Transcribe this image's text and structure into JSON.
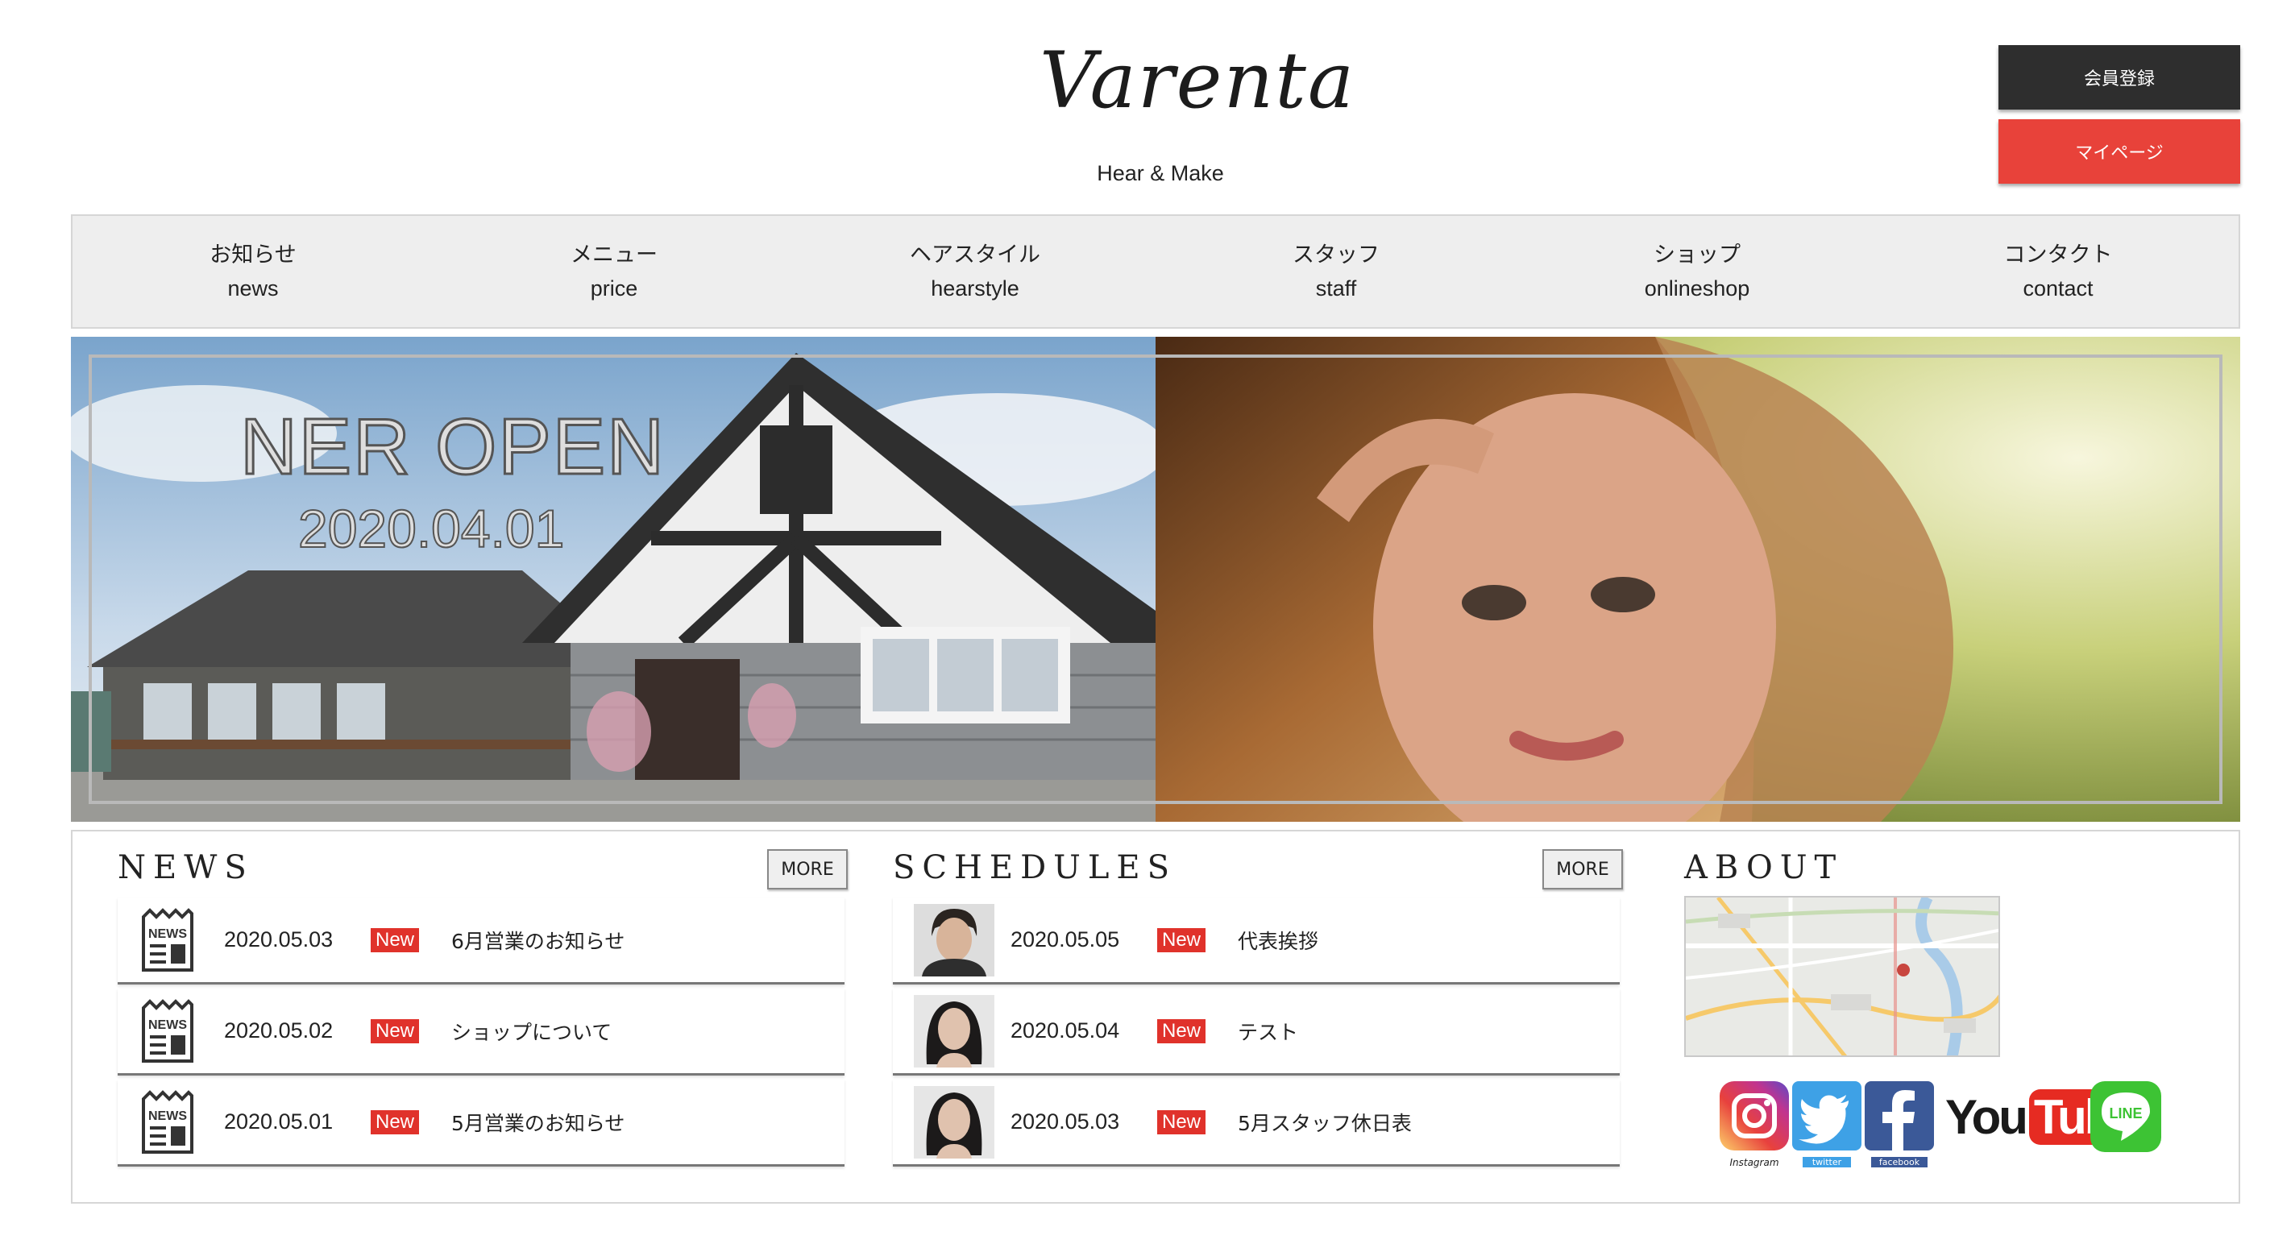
{
  "header": {
    "logo": "Varenta",
    "subtitle": "Hear & Make",
    "member_button": "会員登録",
    "mypage_button": "マイページ"
  },
  "nav": [
    {
      "jp": "お知らせ",
      "en": "news"
    },
    {
      "jp": "メニュー",
      "en": "price"
    },
    {
      "jp": "ヘアスタイル",
      "en": "hearstyle"
    },
    {
      "jp": "スタッフ",
      "en": "staff"
    },
    {
      "jp": "ショップ",
      "en": "onlineshop"
    },
    {
      "jp": "コンタクト",
      "en": "contact"
    }
  ],
  "hero": {
    "title": "NER OPEN",
    "date": "2020.04.01"
  },
  "news": {
    "title": "NEWS",
    "more": "MORE",
    "items": [
      {
        "icon_text": "NEWS",
        "date": "2020.05.03",
        "badge": "New",
        "title": "6月営業のお知らせ"
      },
      {
        "icon_text": "NEWS",
        "date": "2020.05.02",
        "badge": "New",
        "title": "ショップについて"
      },
      {
        "icon_text": "NEWS",
        "date": "2020.05.01",
        "badge": "New",
        "title": "5月営業のお知らせ"
      }
    ]
  },
  "schedules": {
    "title": "SCHEDULES",
    "more": "MORE",
    "items": [
      {
        "date": "2020.05.05",
        "badge": "New",
        "title": "代表挨拶"
      },
      {
        "date": "2020.05.04",
        "badge": "New",
        "title": "テスト"
      },
      {
        "date": "2020.05.03",
        "badge": "New",
        "title": "5月スタッフ休日表"
      }
    ]
  },
  "about": {
    "title": "ABOUT"
  },
  "social": {
    "instagram": "Instagram",
    "twitter": "twitter",
    "facebook": "facebook",
    "youtube_you": "You",
    "youtube_tube": "Tube",
    "line": "LINE"
  },
  "colors": {
    "accent_red": "#e8423a",
    "dark_button": "#2e2e2e",
    "nav_bg": "#eeeeee"
  }
}
